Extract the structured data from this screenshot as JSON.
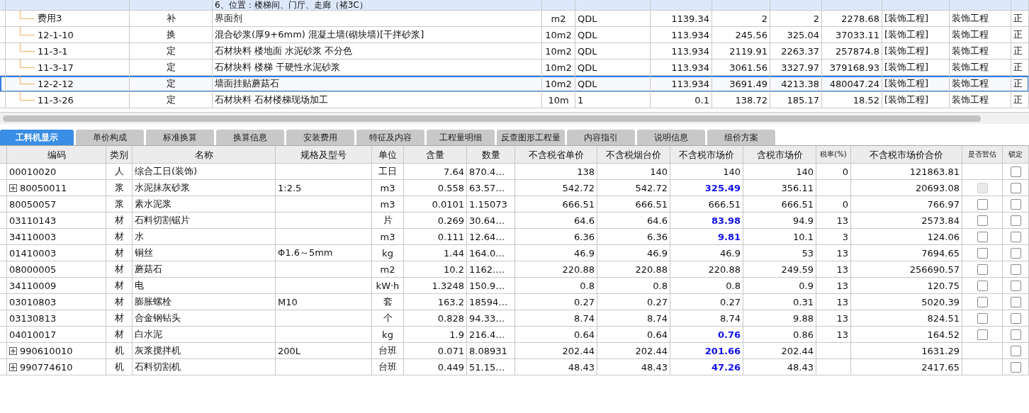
{
  "top_table": {
    "group_row": {
      "text": "6、位置：楼梯间、门厅、走廊（褚3C）"
    },
    "rows": [
      {
        "selected": false,
        "cells": [
          "费用3",
          "补",
          "界面剂",
          "m2",
          "QDL",
          "1139.34",
          "2",
          "2",
          "2278.68",
          "[装饰工程]",
          "装饰工程",
          "正"
        ]
      },
      {
        "selected": false,
        "cells": [
          "12-1-10",
          "换",
          "混合砂浆(厚9+6mm) 混凝土墙(砌块墙)[干拌砂浆]",
          "10m2",
          "QDL",
          "113.934",
          "245.56",
          "325.04",
          "37033.11",
          "[装饰工程]",
          "装饰工程",
          "正"
        ]
      },
      {
        "selected": false,
        "cells": [
          "11-3-1",
          "定",
          "石材块料 楼地面 水泥砂浆 不分色",
          "10m2",
          "QDL",
          "113.934",
          "2119.91",
          "2263.37",
          "257874.8",
          "[装饰工程]",
          "装饰工程",
          "正"
        ]
      },
      {
        "selected": false,
        "cells": [
          "11-3-17",
          "定",
          "石材块料 楼梯 干硬性水泥砂浆",
          "10m2",
          "QDL",
          "113.934",
          "3061.56",
          "3327.97",
          "379168.93",
          "[装饰工程]",
          "装饰工程",
          "正"
        ]
      },
      {
        "selected": true,
        "cells": [
          "12-2-12",
          "定",
          "墙面挂贴蘑菇石",
          "10m2",
          "QDL",
          "113.934",
          "3691.49",
          "4213.38",
          "480047.24",
          "[装饰工程]",
          "装饰工程",
          "正"
        ]
      },
      {
        "selected": false,
        "cells": [
          "11-3-26",
          "定",
          "石材块料 石材楼梯现场加工",
          "10m",
          "1",
          "0.1",
          "138.72",
          "185.17",
          "18.52",
          "[装饰工程]",
          "装饰工程",
          "正"
        ]
      }
    ]
  },
  "tabs": [
    {
      "label": "工料机显示",
      "selected": true
    },
    {
      "label": "单价构成",
      "selected": false
    },
    {
      "label": "标准换算",
      "selected": false
    },
    {
      "label": "换算信息",
      "selected": false
    },
    {
      "label": "安装费用",
      "selected": false
    },
    {
      "label": "特征及内容",
      "selected": false
    },
    {
      "label": "工程量明细",
      "selected": false
    },
    {
      "label": "反查图形工程量",
      "selected": false
    },
    {
      "label": "内容指引",
      "selected": false
    },
    {
      "label": "说明信息",
      "selected": false
    },
    {
      "label": "组价方案",
      "selected": false
    }
  ],
  "materials": {
    "columns": [
      "编码",
      "类别",
      "名称",
      "规格及型号",
      "单位",
      "含量",
      "数量",
      "不含税省单价",
      "不含税烟台价",
      "不含税市场价",
      "含税市场价",
      "税率(%)",
      "不含税市场价合价",
      "是否暂估",
      "锁定"
    ],
    "rows": [
      {
        "code": "00010020",
        "expandable": false,
        "type": "人",
        "name": "综合工日(装饰)",
        "unit": "工日",
        "content": "7.64",
        "quantity": "870.4…",
        "province_price": "138",
        "yantai_price": "140",
        "market_price": "140",
        "market_highlight": false,
        "tax_price": "140",
        "tax_rate": "0",
        "total": "121863.81",
        "estimate": {
          "kind": "none"
        },
        "locked": false
      },
      {
        "code": "80050011",
        "expandable": true,
        "type": "浆",
        "name": "水泥抹灰砂浆",
        "spec": "1:2.5",
        "unit": "m3",
        "content": "0.558",
        "quantity": "63.57…",
        "province_price": "542.72",
        "yantai_price": "542.72",
        "market_price": "325.49",
        "market_highlight": true,
        "tax_price": "356.11",
        "total": "20693.08",
        "estimate": {
          "kind": "disabled",
          "checked": false
        },
        "locked": false
      },
      {
        "code": "80050057",
        "expandable": false,
        "type": "浆",
        "name": "素水泥浆",
        "unit": "m3",
        "content": "0.0101",
        "quantity": "1.15073",
        "province_price": "666.51",
        "yantai_price": "666.51",
        "market_price": "666.51",
        "market_highlight": false,
        "tax_price": "666.51",
        "tax_rate": "0",
        "total": "766.97",
        "estimate": {
          "kind": "checkbox",
          "checked": false
        },
        "locked": false
      },
      {
        "code": "03110143",
        "expandable": false,
        "type": "材",
        "name": "石料切割锯片",
        "unit": "片",
        "content": "0.269",
        "quantity": "30.64…",
        "province_price": "64.6",
        "yantai_price": "64.6",
        "market_price": "83.98",
        "market_highlight": true,
        "tax_price": "94.9",
        "tax_rate": "13",
        "total": "2573.84",
        "estimate": {
          "kind": "checkbox",
          "checked": false
        },
        "locked": false
      },
      {
        "code": "34110003",
        "expandable": false,
        "type": "材",
        "name": "水",
        "unit": "m3",
        "content": "0.111",
        "quantity": "12.64…",
        "province_price": "6.36",
        "yantai_price": "6.36",
        "market_price": "9.81",
        "market_highlight": true,
        "tax_price": "10.1",
        "tax_rate": "3",
        "total": "124.06",
        "estimate": {
          "kind": "checkbox",
          "checked": false
        },
        "locked": false
      },
      {
        "code": "01410003",
        "expandable": false,
        "type": "材",
        "name": "铜丝",
        "spec": "Φ1.6～5mm",
        "unit": "kg",
        "content": "1.44",
        "quantity": "164.0…",
        "province_price": "46.9",
        "yantai_price": "46.9",
        "market_price": "46.9",
        "market_highlight": false,
        "tax_price": "53",
        "tax_rate": "13",
        "total": "7694.65",
        "estimate": {
          "kind": "checkbox",
          "checked": false
        },
        "locked": false
      },
      {
        "code": "08000005",
        "expandable": false,
        "type": "材",
        "name": "蘑菇石",
        "unit": "m2",
        "content": "10.2",
        "quantity": "1162.…",
        "province_price": "220.88",
        "yantai_price": "220.88",
        "market_price": "220.88",
        "market_highlight": false,
        "tax_price": "249.59",
        "tax_rate": "13",
        "total": "256690.57",
        "estimate": {
          "kind": "checkbox",
          "checked": false
        },
        "locked": false
      },
      {
        "code": "34110009",
        "expandable": false,
        "type": "材",
        "name": "电",
        "unit": "kW·h",
        "content": "1.3248",
        "quantity": "150.9…",
        "province_price": "0.8",
        "yantai_price": "0.8",
        "market_price": "0.8",
        "market_highlight": false,
        "tax_price": "0.9",
        "tax_rate": "13",
        "total": "120.75",
        "estimate": {
          "kind": "checkbox",
          "checked": false
        },
        "locked": false
      },
      {
        "code": "03010803",
        "expandable": false,
        "type": "材",
        "name": "膨胀螺栓",
        "spec": "M10",
        "unit": "套",
        "content": "163.2",
        "quantity": "18594…",
        "province_price": "0.27",
        "yantai_price": "0.27",
        "market_price": "0.27",
        "market_highlight": false,
        "tax_price": "0.31",
        "tax_rate": "13",
        "total": "5020.39",
        "estimate": {
          "kind": "checkbox",
          "checked": false
        },
        "locked": false
      },
      {
        "code": "03130813",
        "expandable": false,
        "type": "材",
        "name": "合金钢钻头",
        "unit": "个",
        "content": "0.828",
        "quantity": "94.33…",
        "province_price": "8.74",
        "yantai_price": "8.74",
        "market_price": "8.74",
        "market_highlight": false,
        "tax_price": "9.88",
        "tax_rate": "13",
        "total": "824.51",
        "estimate": {
          "kind": "checkbox",
          "checked": false
        },
        "locked": false
      },
      {
        "code": "04010017",
        "expandable": false,
        "type": "材",
        "name": "白水泥",
        "unit": "kg",
        "content": "1.9",
        "quantity": "216.4…",
        "province_price": "0.64",
        "yantai_price": "0.64",
        "market_price": "0.76",
        "market_highlight": true,
        "tax_price": "0.86",
        "tax_rate": "13",
        "total": "164.52",
        "estimate": {
          "kind": "checkbox",
          "checked": false
        },
        "locked": false
      },
      {
        "code": "990610010",
        "expandable": true,
        "type": "机",
        "name": "灰浆搅拌机",
        "spec": "200L",
        "unit": "台班",
        "content": "0.071",
        "quantity": "8.08931",
        "province_price": "202.44",
        "yantai_price": "202.44",
        "market_price": "201.66",
        "market_highlight": true,
        "tax_price": "202.44",
        "total": "1631.29",
        "estimate": {
          "kind": "none"
        },
        "locked": false
      },
      {
        "code": "990774610",
        "expandable": true,
        "type": "机",
        "name": "石料切割机",
        "unit": "台班",
        "content": "0.449",
        "quantity": "51.15…",
        "province_price": "48.43",
        "yantai_price": "48.43",
        "market_price": "47.26",
        "market_highlight": true,
        "tax_price": "48.43",
        "total": "2417.65",
        "estimate": {
          "kind": "none"
        },
        "locked": false
      }
    ]
  }
}
